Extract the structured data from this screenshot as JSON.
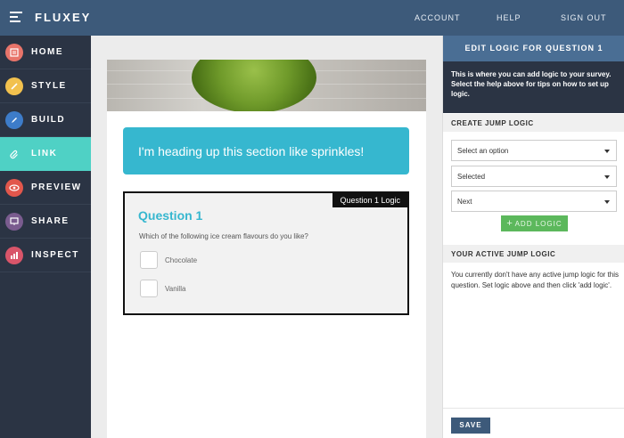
{
  "app": {
    "brand": "FLUXEY",
    "nav": {
      "account": "ACCOUNT",
      "help": "HELP",
      "sign_out": "SIGN OUT"
    }
  },
  "sidebar": {
    "items": [
      {
        "label": "HOME",
        "icon": "home-icon",
        "color": "#e8746a"
      },
      {
        "label": "STYLE",
        "icon": "brush-icon",
        "color": "#f2c14e"
      },
      {
        "label": "BUILD",
        "icon": "pencil-icon",
        "color": "#3d7cc9"
      },
      {
        "label": "LINK",
        "icon": "paperclip-icon",
        "color": "#4fd1c5",
        "active": true
      },
      {
        "label": "PREVIEW",
        "icon": "eye-icon",
        "color": "#e2574c"
      },
      {
        "label": "SHARE",
        "icon": "monitor-icon",
        "color": "#7a5c8f"
      },
      {
        "label": "INSPECT",
        "icon": "chart-icon",
        "color": "#d9556a"
      }
    ]
  },
  "canvas": {
    "banner_text": "I'm heading up this section like sprinkles!",
    "question": {
      "logic_tag": "Question 1 Logic",
      "title": "Question 1",
      "text": "Which of the following ice cream flavours do you like?",
      "options": [
        "Chocolate",
        "Vanilla"
      ]
    }
  },
  "panel": {
    "title": "EDIT LOGIC FOR QUESTION 1",
    "intro": "This is where you can add logic to your survey. Select the help above for tips on how to set up logic.",
    "create_heading": "CREATE JUMP LOGIC",
    "selects": [
      "Select an option",
      "Selected",
      "Next"
    ],
    "add_logic": "ADD LOGIC",
    "active_heading": "YOUR ACTIVE JUMP LOGIC",
    "active_info": "You currently don't have any active jump logic for this question. Set logic above and then click 'add logic'.",
    "save": "SAVE"
  },
  "colors": {
    "topbar": "#3d5a7a",
    "sidebar": "#2b3444",
    "accent": "#36b7cf",
    "active_nav": "#4fd1c5",
    "add_button": "#5cb85c"
  }
}
